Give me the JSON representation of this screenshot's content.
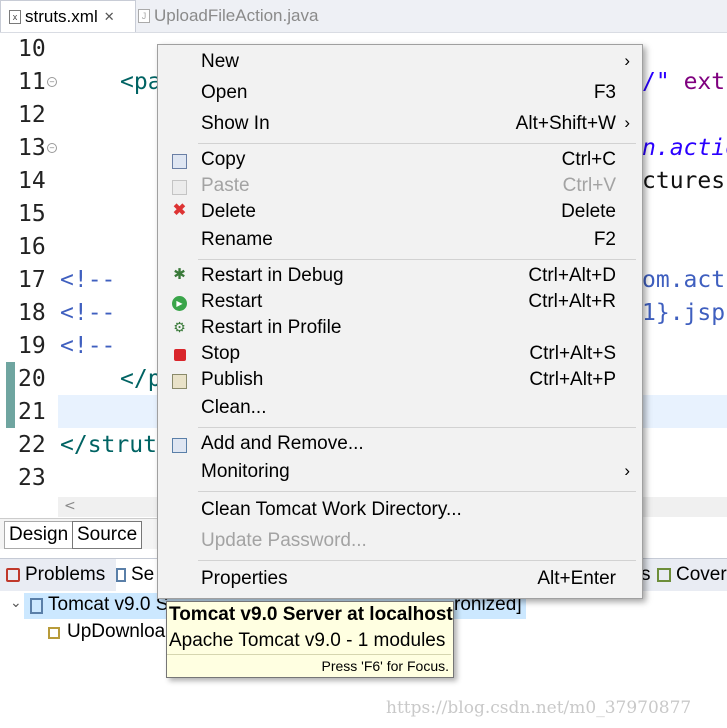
{
  "tabs": [
    {
      "label": "struts.xml",
      "active": true,
      "close": "✕"
    },
    {
      "label": "UploadFileAction.java",
      "active": false
    }
  ],
  "editor": {
    "line_numbers": [
      "10",
      "11",
      "12",
      "13",
      "14",
      "15",
      "16",
      "17",
      "18",
      "19",
      "20",
      "21",
      "22",
      "23"
    ],
    "visible_code": {
      "l11_left": "<pa",
      "l11_right": "/\" ext",
      "l13_right": "n.actio",
      "l14_right": "ctures",
      "l17_left": "<!--",
      "l17_right": "om.acti",
      "l18_left": "<!--",
      "l18_right": "1}.jsp",
      "l19_left": "<!--",
      "l20_left": "</p",
      "l22_left": "</strut"
    },
    "scroll_left_glyph": "<"
  },
  "editor_tabs": {
    "design": "Design",
    "source": "Source"
  },
  "bottom_views": {
    "problems": "Problems",
    "servers_partial": "Se",
    "right_partial": "s",
    "coverage_partial": "Cover"
  },
  "server_tree": {
    "server_partial": "Tomcat v9.0 S",
    "server_tail": "ronized]",
    "module_partial": "UpDownloa"
  },
  "context_menu": {
    "groups": [
      [
        {
          "label": "New",
          "accel": "",
          "submenu": true,
          "icon": ""
        },
        {
          "label": "Open",
          "accel": "F3",
          "submenu": false,
          "icon": ""
        },
        {
          "label": "Show In",
          "accel": "Alt+Shift+W",
          "submenu": true,
          "icon": ""
        }
      ],
      [
        {
          "label": "Copy",
          "accel": "Ctrl+C",
          "icon": "copy-icon"
        },
        {
          "label": "Paste",
          "accel": "Ctrl+V",
          "icon": "paste-icon",
          "disabled": true
        },
        {
          "label": "Delete",
          "accel": "Delete",
          "icon": "delete-icon"
        },
        {
          "label": "Rename",
          "accel": "F2",
          "icon": ""
        }
      ],
      [
        {
          "label": "Restart in Debug",
          "accel": "Ctrl+Alt+D",
          "icon": "debug-icon"
        },
        {
          "label": "Restart",
          "accel": "Ctrl+Alt+R",
          "icon": "run-icon"
        },
        {
          "label": "Restart in Profile",
          "accel": "",
          "icon": "profile-icon"
        },
        {
          "label": "Stop",
          "accel": "Ctrl+Alt+S",
          "icon": "stop-icon"
        },
        {
          "label": "Publish",
          "accel": "Ctrl+Alt+P",
          "icon": "publish-icon"
        },
        {
          "label": "Clean...",
          "accel": "",
          "icon": ""
        }
      ],
      [
        {
          "label": "Add and Remove...",
          "accel": "",
          "icon": "add-remove-icon"
        },
        {
          "label": "Monitoring",
          "accel": "",
          "submenu": true,
          "icon": ""
        }
      ],
      [
        {
          "label": "Clean Tomcat Work Directory...",
          "accel": ""
        },
        {
          "label": "Update Password...",
          "accel": "",
          "disabled": true
        }
      ],
      [
        {
          "label": "Properties",
          "accel": "Alt+Enter"
        }
      ]
    ],
    "submenu_glyph": "›"
  },
  "tooltip": {
    "title": "Tomcat v9.0 Server at localhost",
    "subtitle": "Apache Tomcat v9.0 - 1 modules",
    "hint": "Press 'F6' for Focus."
  },
  "watermark": "https://blog.csdn.net/m0_37970877",
  "colors": {
    "menu_bg": "#f2f2f2",
    "tooltip_bg": "#ffffe1",
    "selection": "#cce8ff",
    "current_line": "#e8f2fe"
  }
}
